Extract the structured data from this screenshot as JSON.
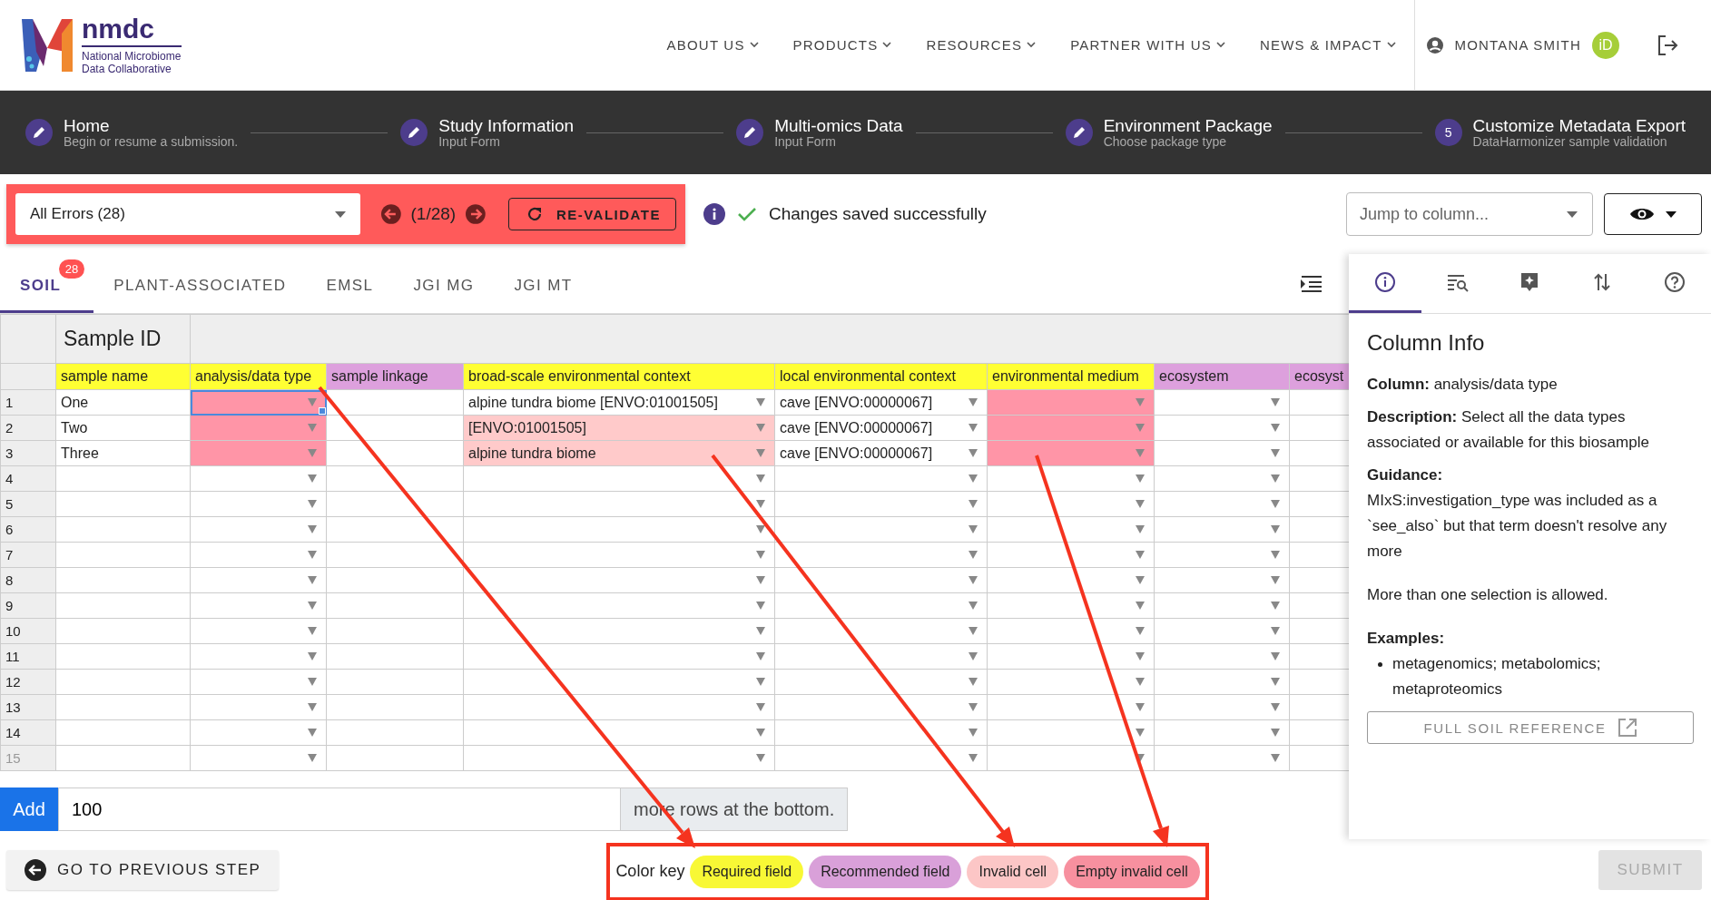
{
  "header": {
    "logo": {
      "name": "nmdc",
      "subtitle_lines": [
        "National Microbiome",
        "Data Collaborative"
      ]
    },
    "nav": [
      {
        "label": "ABOUT US"
      },
      {
        "label": "PRODUCTS"
      },
      {
        "label": "RESOURCES"
      },
      {
        "label": "PARTNER WITH US"
      },
      {
        "label": "NEWS & IMPACT"
      }
    ],
    "user": {
      "name": "MONTANA SMITH",
      "badge": "iD"
    }
  },
  "steps": [
    {
      "kind": "done",
      "title": "Home",
      "subtitle": "Begin or resume a submission."
    },
    {
      "kind": "done",
      "title": "Study Information",
      "subtitle": "Input Form"
    },
    {
      "kind": "done",
      "title": "Multi-omics Data",
      "subtitle": "Input Form"
    },
    {
      "kind": "done",
      "title": "Environment Package",
      "subtitle": "Choose package type"
    },
    {
      "kind": "current",
      "number": "5",
      "title": "Customize Metadata Export",
      "subtitle": "DataHarmonizer sample validation"
    }
  ],
  "toolbar": {
    "error_filter": "All Errors (28)",
    "counter": "(1/28)",
    "revalidate": "RE-VALIDATE",
    "status": "Changes saved successfully",
    "jump_placeholder": "Jump to column..."
  },
  "tabs": [
    {
      "label": "SOIL",
      "selected": true,
      "badge": "28"
    },
    {
      "label": "PLANT-ASSOCIATED",
      "selected": false
    },
    {
      "label": "EMSL",
      "selected": false
    },
    {
      "label": "JGI MG",
      "selected": false
    },
    {
      "label": "JGI MT",
      "selected": false
    }
  ],
  "table": {
    "group_header": "Sample ID",
    "columns": [
      {
        "label": "sample name",
        "color": "#ffff33",
        "dropdown": false
      },
      {
        "label": "analysis/data type",
        "color": "#ffff33",
        "dropdown": true
      },
      {
        "label": "sample linkage",
        "color": "#dda0dd",
        "dropdown": false
      },
      {
        "label": "broad-scale environmental context",
        "color": "#ffff33",
        "dropdown": true
      },
      {
        "label": "local environmental context",
        "color": "#ffff33",
        "dropdown": true
      },
      {
        "label": "environmental medium",
        "color": "#ffff33",
        "dropdown": true
      },
      {
        "label": "ecosystem",
        "color": "#dda0dd",
        "dropdown": true
      },
      {
        "label": "ecosyst",
        "color": "#dda0dd",
        "dropdown": false
      }
    ],
    "rows": [
      {
        "number": "1",
        "cells": [
          {
            "value": "One",
            "invalid": false,
            "selected": false
          },
          {
            "invalid": true,
            "selected": true
          },
          {
            "invalid": false,
            "selected": false
          },
          {
            "value": "alpine tundra biome [ENVO:01001505]",
            "invalid": false,
            "selected": false
          },
          {
            "value": "cave [ENVO:00000067]",
            "invalid": false,
            "selected": false
          },
          {
            "invalid": true,
            "selected": false
          },
          {
            "invalid": false,
            "selected": false
          },
          {
            "invalid": false,
            "selected": false
          }
        ]
      },
      {
        "number": "2",
        "cells": [
          {
            "value": "Two",
            "invalid": false,
            "selected": false
          },
          {
            "invalid": true,
            "selected": false
          },
          {
            "invalid": false,
            "selected": false
          },
          {
            "value": "[ENVO:01001505]",
            "invalid": true,
            "selected": false
          },
          {
            "value": "cave [ENVO:00000067]",
            "invalid": false,
            "selected": false
          },
          {
            "invalid": true,
            "selected": false
          },
          {
            "invalid": false,
            "selected": false
          },
          {
            "invalid": false,
            "selected": false
          }
        ]
      },
      {
        "number": "3",
        "cells": [
          {
            "value": "Three",
            "invalid": false,
            "selected": false
          },
          {
            "invalid": true,
            "selected": false
          },
          {
            "invalid": false,
            "selected": false
          },
          {
            "value": "alpine tundra biome",
            "invalid": true,
            "selected": false
          },
          {
            "value": "cave [ENVO:00000067]",
            "invalid": false,
            "selected": false
          },
          {
            "invalid": true,
            "selected": false
          },
          {
            "invalid": false,
            "selected": false
          },
          {
            "invalid": false,
            "selected": false
          }
        ]
      },
      {
        "number": "4"
      },
      {
        "number": "5"
      },
      {
        "number": "6"
      },
      {
        "number": "7"
      },
      {
        "number": "8"
      },
      {
        "number": "9"
      },
      {
        "number": "10"
      },
      {
        "number": "11"
      },
      {
        "number": "12"
      },
      {
        "number": "13"
      },
      {
        "number": "14"
      },
      {
        "number": "15"
      }
    ]
  },
  "panel": {
    "tabs": [
      {
        "kind": "info",
        "selected": true
      },
      {
        "kind": "search",
        "selected": false
      },
      {
        "kind": "note",
        "selected": false
      },
      {
        "kind": "sort",
        "selected": false
      },
      {
        "kind": "help",
        "selected": false
      }
    ],
    "title": "Column Info",
    "column": "**Column:**  analysis/data type",
    "description": "**Description:**  Select all the data types associated or available for this biosample",
    "guidance_label": "Guidance:",
    "guidance": "MIxS:investigation_type was included as a `see_also` but that term doesn't resolve any more",
    "note": "More than one selection is allowed.",
    "examples_label": "Examples:",
    "examples": [
      "metagenomics; metabolomics; metaproteomics"
    ],
    "reference_button": "FULL SOIL REFERENCE"
  },
  "add_rows": {
    "button": "Add",
    "value": "100",
    "suffix": "more rows at the bottom."
  },
  "footer": {
    "previous_button": "GO TO PREVIOUS STEP",
    "color_key": {
      "label": "Color key",
      "items": [
        {
          "label": "Required field",
          "color": "#f8f835"
        },
        {
          "label": "Recommended field",
          "color": "#d9a0d9"
        },
        {
          "label": "Invalid cell",
          "color": "#fcc6c6"
        },
        {
          "label": "Empty invalid cell",
          "color": "#f7909f"
        }
      ]
    },
    "submit": {
      "label": "SUBMIT",
      "disabled": true
    }
  }
}
